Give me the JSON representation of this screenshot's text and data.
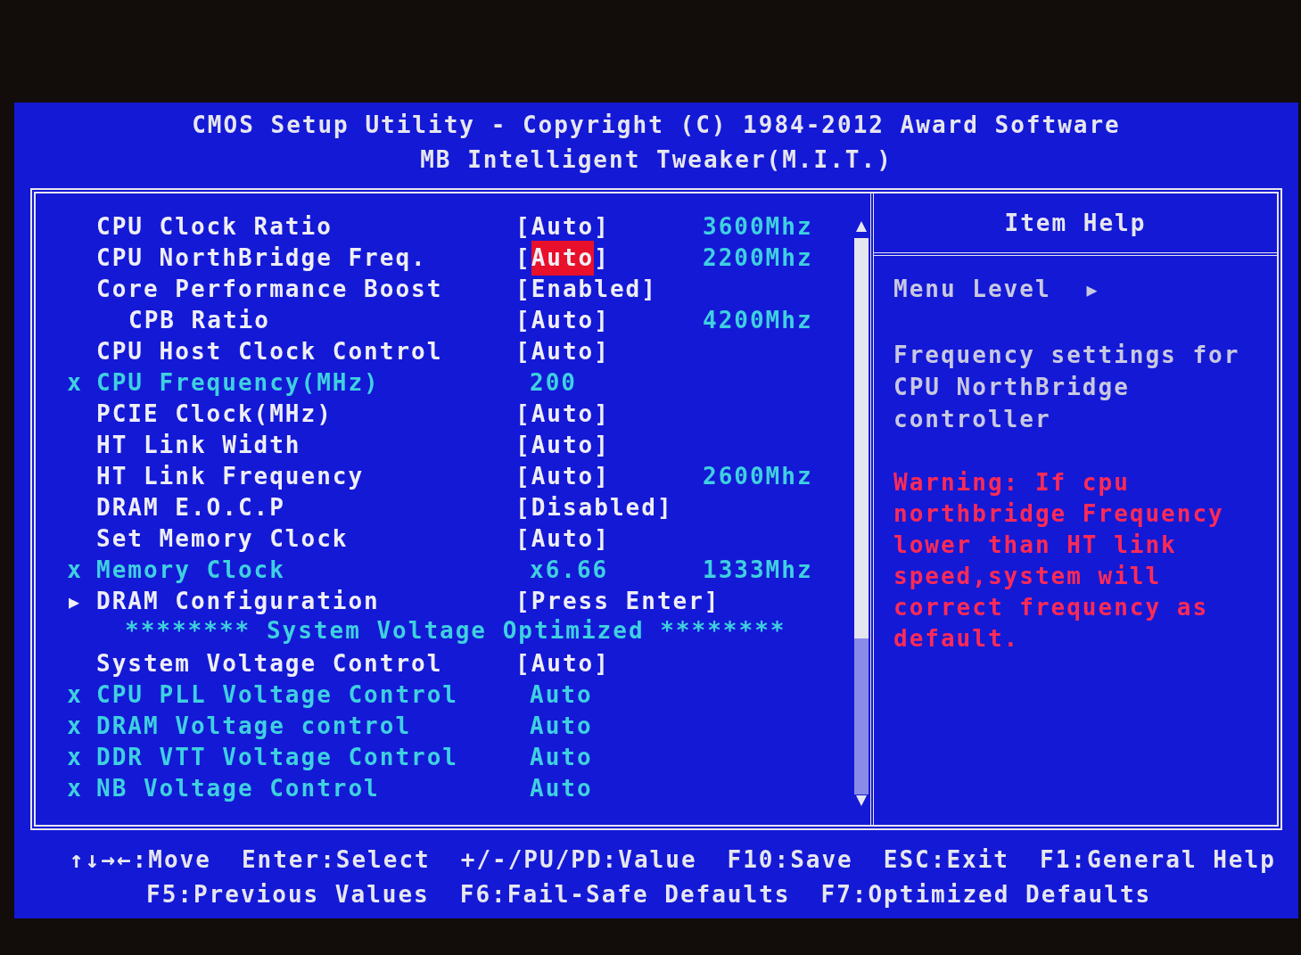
{
  "header": {
    "title": "CMOS Setup Utility - Copyright (C) 1984-2012 Award Software",
    "subtitle": "MB Intelligent Tweaker(M.I.T.)"
  },
  "rows": [
    {
      "kind": "setting",
      "label": "CPU Clock Ratio",
      "value": [
        "[",
        "Auto",
        "]"
      ],
      "reading": "3600Mhz",
      "selected": false
    },
    {
      "kind": "setting",
      "label": "CPU NorthBridge Freq.",
      "value": [
        "[",
        "Auto",
        "]"
      ],
      "reading": "2200Mhz",
      "selected": true
    },
    {
      "kind": "setting",
      "label": "Core Performance Boost",
      "value": [
        "[",
        "Enabled",
        "]"
      ],
      "selected": false,
      "children": [
        {
          "kind": "setting",
          "label": "CPB Ratio",
          "value": [
            "[",
            "Auto",
            "]"
          ],
          "reading": "4200Mhz",
          "selected": false
        }
      ]
    },
    {
      "kind": "setting",
      "label": "CPU Host Clock Control",
      "value": [
        "[",
        "Auto",
        "]"
      ],
      "selected": false
    },
    {
      "kind": "locked",
      "marker": "x",
      "label": "CPU Frequency(MHz)",
      "value": [
        "200"
      ],
      "selected": false
    },
    {
      "kind": "setting",
      "label": "PCIE Clock(MHz)",
      "value": [
        "[",
        "Auto",
        "]"
      ],
      "selected": false
    },
    {
      "kind": "setting",
      "label": "HT Link Width",
      "value": [
        "[",
        "Auto",
        "]"
      ],
      "selected": false
    },
    {
      "kind": "setting",
      "label": "HT Link Frequency",
      "value": [
        "[",
        "Auto",
        "]"
      ],
      "reading": "2600Mhz",
      "selected": false
    },
    {
      "kind": "setting",
      "label": "DRAM E.O.C.P",
      "value": [
        "[",
        "Disabled",
        "]"
      ],
      "selected": false
    },
    {
      "kind": "setting",
      "label": "Set Memory Clock",
      "value": [
        "[",
        "Auto",
        "]"
      ],
      "selected": false
    },
    {
      "kind": "locked",
      "marker": "x",
      "label": "Memory Clock",
      "value": [
        "x6.66"
      ],
      "reading": "1333Mhz",
      "selected": false
    },
    {
      "kind": "submenu",
      "marker": "▶",
      "label": "DRAM Configuration",
      "value": [
        "[",
        "Press Enter",
        "]"
      ],
      "selected": false
    },
    {
      "kind": "heading",
      "label": "******** System Voltage Optimized ********"
    },
    {
      "kind": "setting",
      "label": "System Voltage Control",
      "value": [
        "[",
        "Auto",
        "]"
      ],
      "selected": false
    },
    {
      "kind": "locked",
      "marker": "x",
      "label": "CPU PLL Voltage Control",
      "value": [
        "Auto"
      ],
      "selected": false
    },
    {
      "kind": "locked",
      "marker": "x",
      "label": "DRAM Voltage control",
      "value": [
        "Auto"
      ],
      "selected": false
    },
    {
      "kind": "locked",
      "marker": "x",
      "label": "DDR VTT Voltage Control",
      "value": [
        "Auto"
      ],
      "selected": false
    },
    {
      "kind": "locked",
      "marker": "x",
      "label": "NB Voltage Control",
      "value": [
        "Auto"
      ],
      "selected": false
    }
  ],
  "help": {
    "title": "Item Help",
    "menu_level": "Menu Level",
    "menu_level_marker": "▶",
    "text": "Frequency settings for CPU NorthBridge controller",
    "warning": "Warning: If cpu northbridge Frequency lower than HT link speed,system will correct frequency as default."
  },
  "keys": [
    [
      "↑↓→←:Move",
      "Enter:Select",
      "+/-/PU/PD:Value",
      "F10:Save",
      "ESC:Exit",
      "F1:General Help"
    ],
    [
      "F5:Previous Values",
      "F6:Fail-Safe Defaults",
      "F7:Optimized Defaults"
    ]
  ]
}
